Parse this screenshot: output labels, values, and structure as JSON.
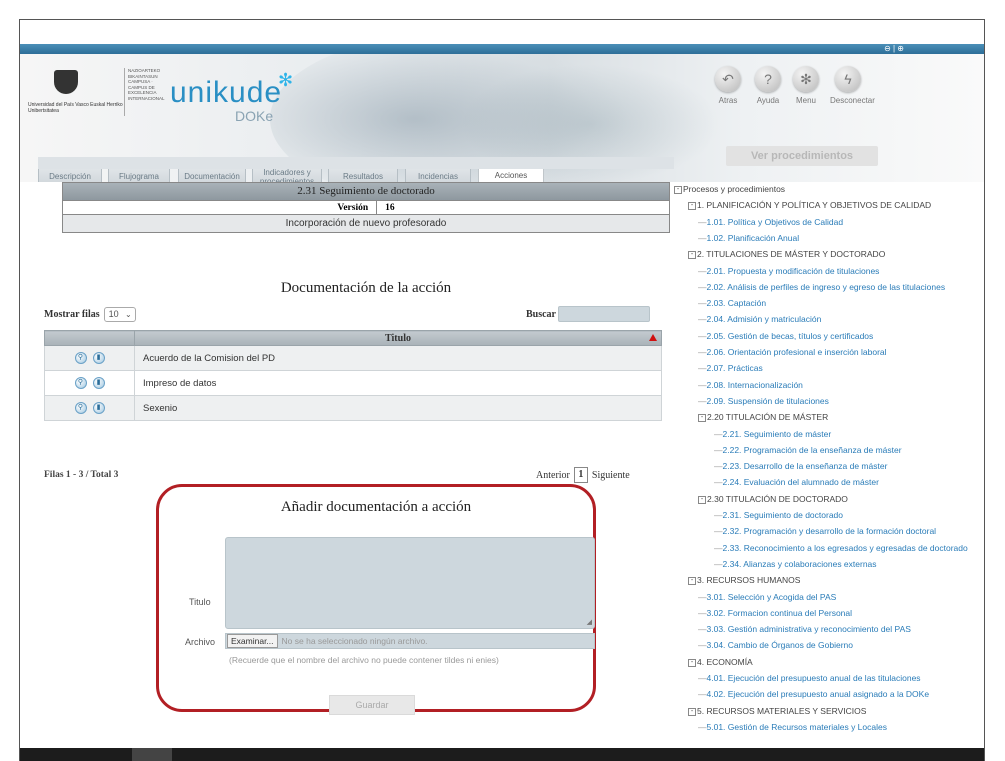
{
  "header": {
    "brand": "unikude",
    "brand_sub": "DOKe",
    "upv_text": "Universidad del País Vasco  Euskal Herriko Unibertsitatea",
    "campus_text": "NAZIOARTEKO BIKAINTASUN CAMPUSA · CAMPUS DE EXCELENCIA INTERNACIONAL",
    "topbar_icons": "⊖ | ⊕",
    "nav": [
      {
        "label": "Atras",
        "icon": "back-arrow-icon",
        "glyph": "↶"
      },
      {
        "label": "Ayuda",
        "icon": "help-icon",
        "glyph": "?"
      },
      {
        "label": "Menu",
        "icon": "menu-snowflake-icon",
        "glyph": "✻"
      },
      {
        "label": "Desconectar",
        "icon": "lightning-icon",
        "glyph": "ϟ"
      }
    ],
    "ver_procedimientos": "Ver procedimientos"
  },
  "tabs": [
    {
      "label": "Descripción"
    },
    {
      "label": "Flujograma"
    },
    {
      "label": "Documentación"
    },
    {
      "label": "Indicadores y procedimientos"
    },
    {
      "label": "Resultados"
    },
    {
      "label": "Incidencias"
    },
    {
      "label": "Acciones",
      "active": true
    }
  ],
  "process": {
    "title": "2.31 Seguimiento de doctorado",
    "version_label": "Versión",
    "version_number": "16",
    "subtitle": "Incorporación de nuevo profesorado"
  },
  "documents": {
    "heading": "Documentación de la acción",
    "show_rows_label": "Mostrar filas",
    "show_rows_value": "10",
    "search_label": "Buscar",
    "column_title": "Titulo",
    "rows": [
      {
        "title": "Acuerdo de la Comision del PD"
      },
      {
        "title": "Impreso de datos"
      },
      {
        "title": "Sexenio"
      }
    ],
    "rows_info": "Filas 1 - 3 / Total 3",
    "prev": "Anterior",
    "page": "1",
    "next": "Siguiente"
  },
  "add_doc": {
    "heading": "Añadir documentación a acción",
    "title_label": "Titulo",
    "file_label": "Archivo",
    "browse": "Examinar...",
    "no_file": "No se ha seleccionado ningún archivo.",
    "hint": "(Recuerde que el nombre del archivo no puede contener tildes ni enies)",
    "save": "Guardar",
    "highlight_color": "#b21f24"
  },
  "tree": {
    "root": "Procesos y procedimientos",
    "items": [
      {
        "text": "1. PLANIFICACIÓN Y POLÍTICA Y OBJETIVOS DE CALIDAD",
        "level": 1,
        "toggle": "-"
      },
      {
        "text": "1.01. Política y Objetivos de Calidad",
        "level": 2,
        "link": true
      },
      {
        "text": "1.02. Planificación Anual",
        "level": 2,
        "link": true
      },
      {
        "text": "2. TITULACIONES DE MÁSTER Y DOCTORADO",
        "level": 1,
        "toggle": "-"
      },
      {
        "text": "2.01. Propuesta y modificación de titulaciones",
        "level": 2,
        "link": true
      },
      {
        "text": "2.02. Análisis de perfiles de ingreso y egreso de las titulaciones",
        "level": 2,
        "link": true
      },
      {
        "text": "2.03. Captación",
        "level": 2,
        "link": true
      },
      {
        "text": "2.04. Admisión y matriculación",
        "level": 2,
        "link": true
      },
      {
        "text": "2.05. Gestión de becas, títulos y certificados",
        "level": 2,
        "link": true
      },
      {
        "text": "2.06. Orientación profesional e inserción laboral",
        "level": 2,
        "link": true
      },
      {
        "text": "2.07. Prácticas",
        "level": 2,
        "link": true
      },
      {
        "text": "2.08. Internacionalización",
        "level": 2,
        "link": true
      },
      {
        "text": "2.09. Suspensión de titulaciones",
        "level": 2,
        "link": true
      },
      {
        "text": "2.20 TITULACIÓN DE MÁSTER",
        "level": 2,
        "toggle": "-"
      },
      {
        "text": "2.21. Seguimiento de máster",
        "level": 3,
        "link": true
      },
      {
        "text": "2.22. Programación de la enseñanza de máster",
        "level": 3,
        "link": true
      },
      {
        "text": "2.23. Desarrollo de la enseñanza de máster",
        "level": 3,
        "link": true
      },
      {
        "text": "2.24. Evaluación del alumnado de máster",
        "level": 3,
        "link": true
      },
      {
        "text": "2.30 TITULACIÓN DE DOCTORADO",
        "level": 2,
        "toggle": "-"
      },
      {
        "text": "2.31. Seguimiento de doctorado",
        "level": 3,
        "link": true
      },
      {
        "text": "2.32. Programación y desarrollo de la formación doctoral",
        "level": 3,
        "link": true
      },
      {
        "text": "2.33. Reconocimiento a los egresados y egresadas de doctorado",
        "level": 3,
        "link": true
      },
      {
        "text": "2.34. Alianzas y colaboraciones externas",
        "level": 3,
        "link": true
      },
      {
        "text": "3. RECURSOS HUMANOS",
        "level": 1,
        "toggle": "-"
      },
      {
        "text": "3.01. Selección y Acogida del PAS",
        "level": 2,
        "link": true
      },
      {
        "text": "3.02. Formacion continua del Personal",
        "level": 2,
        "link": true
      },
      {
        "text": "3.03. Gestión administrativa y reconocimiento del PAS",
        "level": 2,
        "link": true
      },
      {
        "text": "3.04. Cambio de Órganos de Gobierno",
        "level": 2,
        "link": true
      },
      {
        "text": "4. ECONOMÍA",
        "level": 1,
        "toggle": "-"
      },
      {
        "text": "4.01. Ejecución del presupuesto anual de las titulaciones",
        "level": 2,
        "link": true
      },
      {
        "text": "4.02. Ejecución del presupuesto anual asignado a la DOKe",
        "level": 2,
        "link": true
      },
      {
        "text": "5. RECURSOS MATERIALES Y SERVICIOS",
        "level": 1,
        "toggle": "-"
      },
      {
        "text": "5.01. Gestión de Recursos materiales y Locales",
        "level": 2,
        "link": true
      }
    ]
  }
}
